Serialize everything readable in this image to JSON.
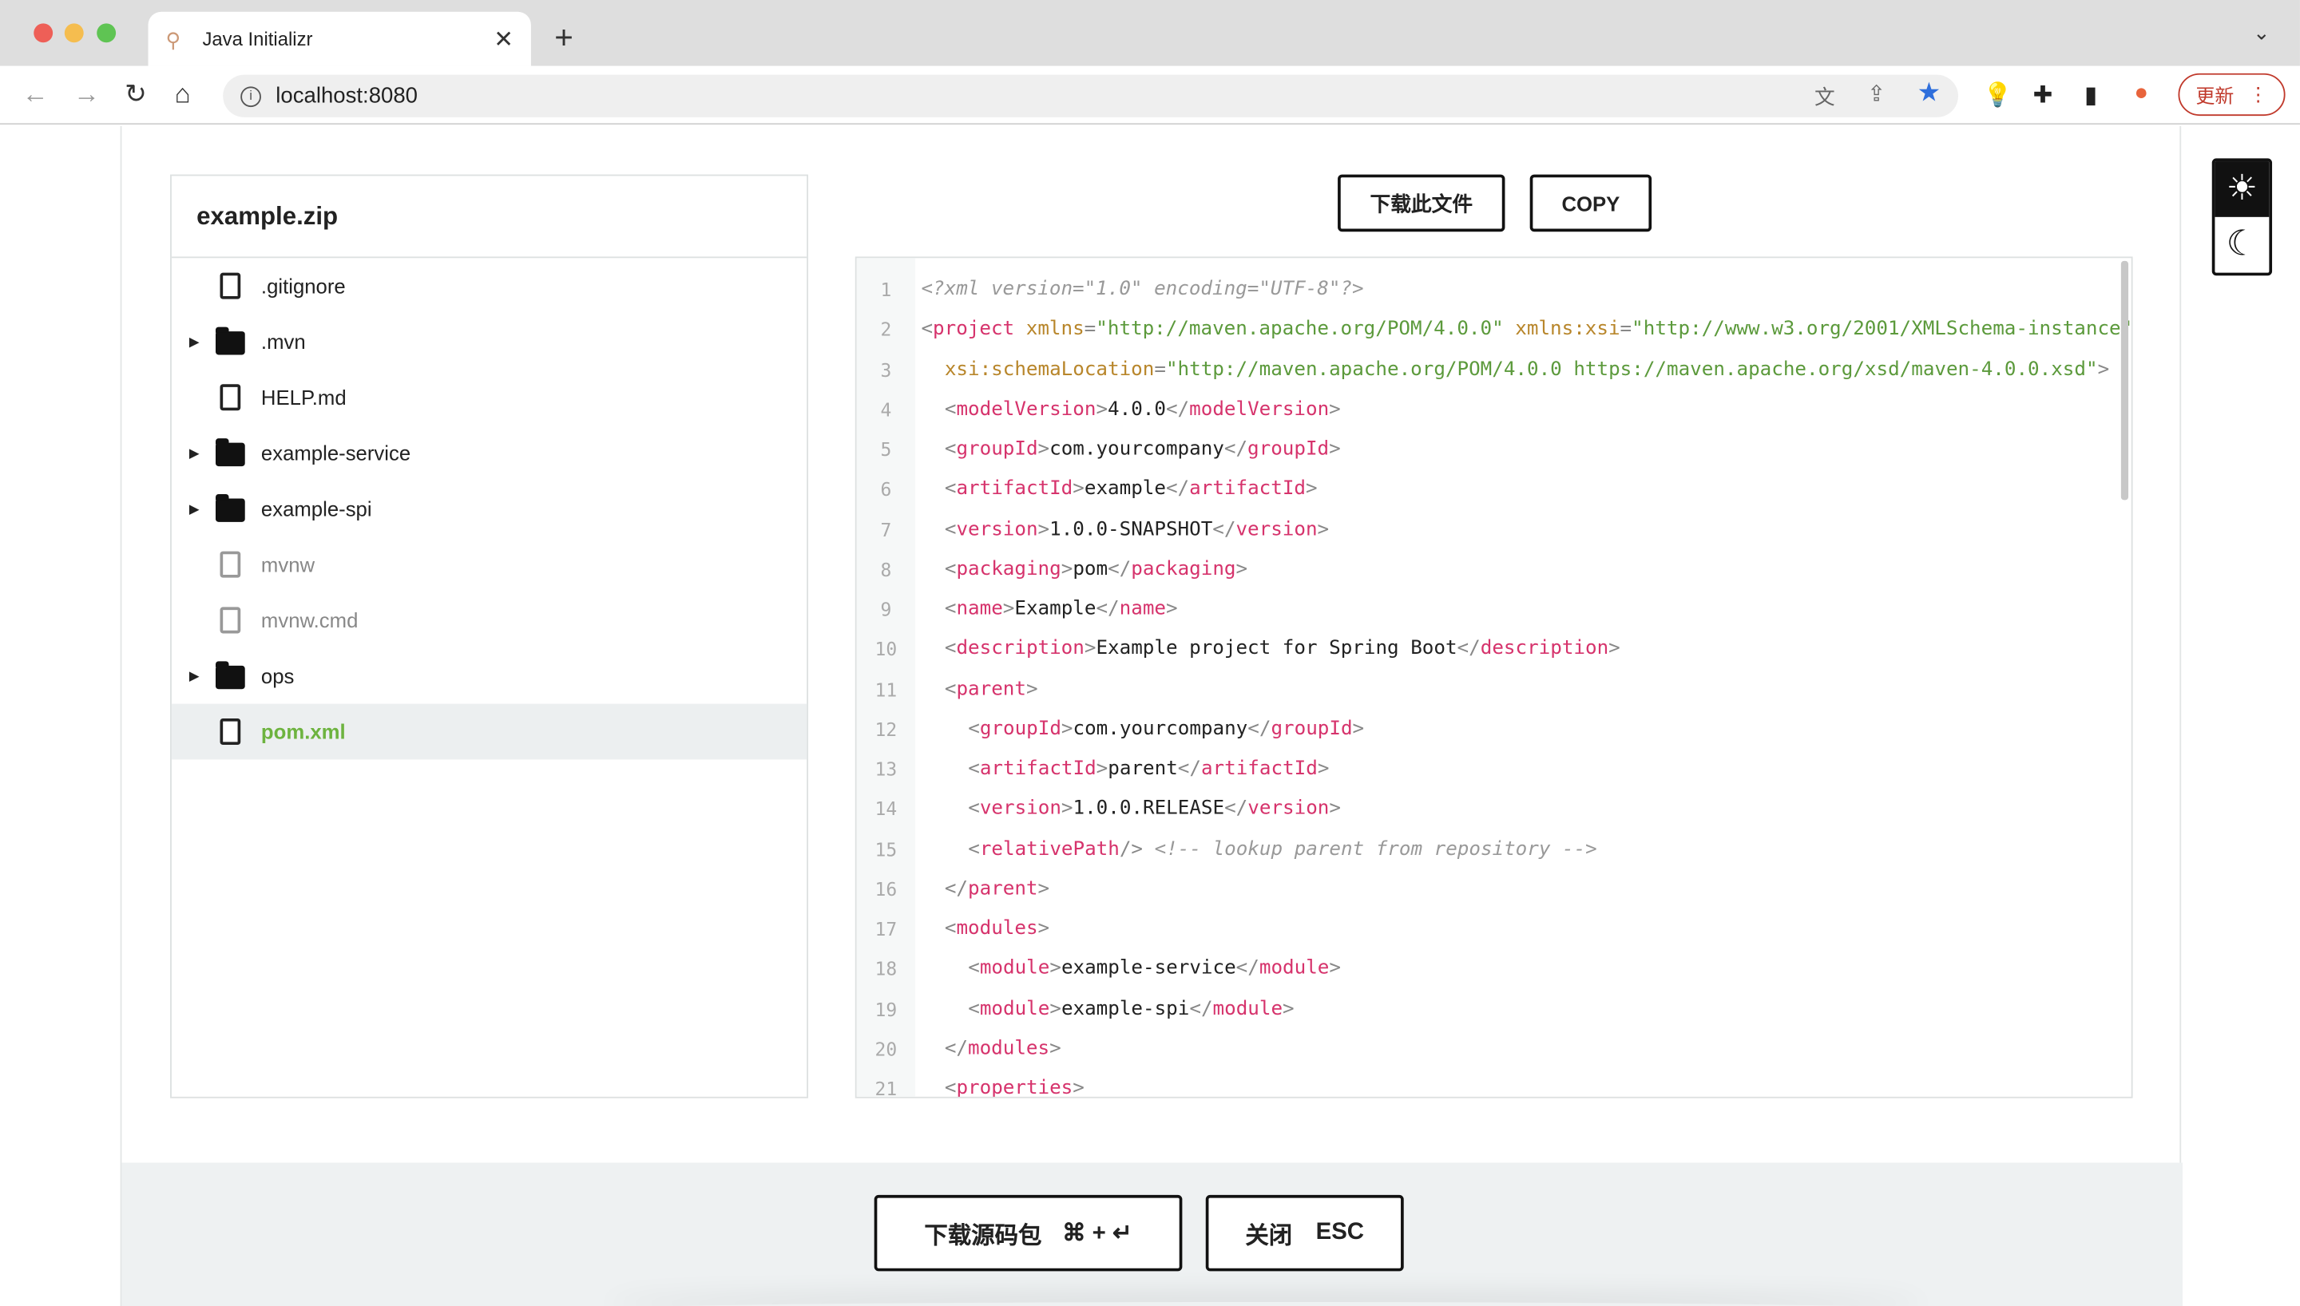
{
  "browser": {
    "tab_title": "Java Initializr",
    "url": "localhost:8080",
    "update_label": "更新",
    "colors": {
      "close": "#ee5f57",
      "minimize": "#f5bd4f",
      "maximize": "#5fc453"
    }
  },
  "tree": {
    "title": "example.zip",
    "items": [
      {
        "label": ".gitignore",
        "type": "file"
      },
      {
        "label": ".mvn",
        "type": "folder"
      },
      {
        "label": "HELP.md",
        "type": "file"
      },
      {
        "label": "example-service",
        "type": "folder"
      },
      {
        "label": "example-spi",
        "type": "folder"
      },
      {
        "label": "mvnw",
        "type": "file",
        "dim": true
      },
      {
        "label": "mvnw.cmd",
        "type": "file",
        "dim": true
      },
      {
        "label": "ops",
        "type": "folder"
      },
      {
        "label": "pom.xml",
        "type": "file",
        "selected": true
      }
    ]
  },
  "actions": {
    "download_file": "下载此文件",
    "copy": "COPY"
  },
  "code": {
    "lines": [
      {
        "n": "1",
        "i": 0,
        "t": [
          [
            "com",
            "<?xml version=\"1.0\" encoding=\"UTF-8\"?>"
          ]
        ]
      },
      {
        "n": "2",
        "i": 0,
        "t": [
          [
            "p",
            "<"
          ],
          [
            "tag",
            "project"
          ],
          [
            "txt",
            " "
          ],
          [
            "attr",
            "xmlns"
          ],
          [
            "p",
            "="
          ],
          [
            "val",
            "\"http://maven.apache.org/POM/4.0.0\""
          ],
          [
            "txt",
            " "
          ],
          [
            "attr",
            "xmlns:xsi"
          ],
          [
            "p",
            "="
          ],
          [
            "val",
            "\"http://www.w3.org/2001/XMLSchema-instance\""
          ]
        ]
      },
      {
        "n": "3",
        "i": 1,
        "t": [
          [
            "attr",
            "xsi:schemaLocation"
          ],
          [
            "p",
            "="
          ],
          [
            "val",
            "\"http://maven.apache.org/POM/4.0.0 https://maven.apache.org/xsd/maven-4.0.0.xsd\""
          ],
          [
            "p",
            ">"
          ]
        ]
      },
      {
        "n": "4",
        "i": 1,
        "t": [
          [
            "p",
            "<"
          ],
          [
            "tag",
            "modelVersion"
          ],
          [
            "p",
            ">"
          ],
          [
            "txt",
            "4.0.0"
          ],
          [
            "p",
            "</"
          ],
          [
            "tag",
            "modelVersion"
          ],
          [
            "p",
            ">"
          ]
        ]
      },
      {
        "n": "5",
        "i": 1,
        "t": [
          [
            "p",
            "<"
          ],
          [
            "tag",
            "groupId"
          ],
          [
            "p",
            ">"
          ],
          [
            "txt",
            "com.yourcompany"
          ],
          [
            "p",
            "</"
          ],
          [
            "tag",
            "groupId"
          ],
          [
            "p",
            ">"
          ]
        ]
      },
      {
        "n": "6",
        "i": 1,
        "t": [
          [
            "p",
            "<"
          ],
          [
            "tag",
            "artifactId"
          ],
          [
            "p",
            ">"
          ],
          [
            "txt",
            "example"
          ],
          [
            "p",
            "</"
          ],
          [
            "tag",
            "artifactId"
          ],
          [
            "p",
            ">"
          ]
        ]
      },
      {
        "n": "7",
        "i": 1,
        "t": [
          [
            "p",
            "<"
          ],
          [
            "tag",
            "version"
          ],
          [
            "p",
            ">"
          ],
          [
            "txt",
            "1.0.0-SNAPSHOT"
          ],
          [
            "p",
            "</"
          ],
          [
            "tag",
            "version"
          ],
          [
            "p",
            ">"
          ]
        ]
      },
      {
        "n": "8",
        "i": 1,
        "t": [
          [
            "p",
            "<"
          ],
          [
            "tag",
            "packaging"
          ],
          [
            "p",
            ">"
          ],
          [
            "txt",
            "pom"
          ],
          [
            "p",
            "</"
          ],
          [
            "tag",
            "packaging"
          ],
          [
            "p",
            ">"
          ]
        ]
      },
      {
        "n": "9",
        "i": 1,
        "t": [
          [
            "p",
            "<"
          ],
          [
            "tag",
            "name"
          ],
          [
            "p",
            ">"
          ],
          [
            "txt",
            "Example"
          ],
          [
            "p",
            "</"
          ],
          [
            "tag",
            "name"
          ],
          [
            "p",
            ">"
          ]
        ]
      },
      {
        "n": "10",
        "i": 1,
        "t": [
          [
            "p",
            "<"
          ],
          [
            "tag",
            "description"
          ],
          [
            "p",
            ">"
          ],
          [
            "txt",
            "Example project for Spring Boot"
          ],
          [
            "p",
            "</"
          ],
          [
            "tag",
            "description"
          ],
          [
            "p",
            ">"
          ]
        ]
      },
      {
        "n": "11",
        "i": 1,
        "t": [
          [
            "p",
            "<"
          ],
          [
            "tag",
            "parent"
          ],
          [
            "p",
            ">"
          ]
        ]
      },
      {
        "n": "12",
        "i": 2,
        "t": [
          [
            "p",
            "<"
          ],
          [
            "tag",
            "groupId"
          ],
          [
            "p",
            ">"
          ],
          [
            "txt",
            "com.yourcompany"
          ],
          [
            "p",
            "</"
          ],
          [
            "tag",
            "groupId"
          ],
          [
            "p",
            ">"
          ]
        ]
      },
      {
        "n": "13",
        "i": 2,
        "t": [
          [
            "p",
            "<"
          ],
          [
            "tag",
            "artifactId"
          ],
          [
            "p",
            ">"
          ],
          [
            "txt",
            "parent"
          ],
          [
            "p",
            "</"
          ],
          [
            "tag",
            "artifactId"
          ],
          [
            "p",
            ">"
          ]
        ]
      },
      {
        "n": "14",
        "i": 2,
        "t": [
          [
            "p",
            "<"
          ],
          [
            "tag",
            "version"
          ],
          [
            "p",
            ">"
          ],
          [
            "txt",
            "1.0.0.RELEASE"
          ],
          [
            "p",
            "</"
          ],
          [
            "tag",
            "version"
          ],
          [
            "p",
            ">"
          ]
        ]
      },
      {
        "n": "15",
        "i": 2,
        "t": [
          [
            "p",
            "<"
          ],
          [
            "tag",
            "relativePath"
          ],
          [
            "p",
            "/>"
          ],
          [
            "txt",
            " "
          ],
          [
            "com",
            "<!-- lookup parent from repository -->"
          ]
        ]
      },
      {
        "n": "16",
        "i": 1,
        "t": [
          [
            "p",
            "</"
          ],
          [
            "tag",
            "parent"
          ],
          [
            "p",
            ">"
          ]
        ]
      },
      {
        "n": "17",
        "i": 1,
        "t": [
          [
            "p",
            "<"
          ],
          [
            "tag",
            "modules"
          ],
          [
            "p",
            ">"
          ]
        ]
      },
      {
        "n": "18",
        "i": 2,
        "t": [
          [
            "p",
            "<"
          ],
          [
            "tag",
            "module"
          ],
          [
            "p",
            ">"
          ],
          [
            "txt",
            "example-service"
          ],
          [
            "p",
            "</"
          ],
          [
            "tag",
            "module"
          ],
          [
            "p",
            ">"
          ]
        ]
      },
      {
        "n": "19",
        "i": 2,
        "t": [
          [
            "p",
            "<"
          ],
          [
            "tag",
            "module"
          ],
          [
            "p",
            ">"
          ],
          [
            "txt",
            "example-spi"
          ],
          [
            "p",
            "</"
          ],
          [
            "tag",
            "module"
          ],
          [
            "p",
            ">"
          ]
        ]
      },
      {
        "n": "20",
        "i": 1,
        "t": [
          [
            "p",
            "</"
          ],
          [
            "tag",
            "modules"
          ],
          [
            "p",
            ">"
          ]
        ]
      },
      {
        "n": "21",
        "i": 1,
        "t": [
          [
            "p",
            "<"
          ],
          [
            "tag",
            "properties"
          ],
          [
            "p",
            ">"
          ]
        ]
      }
    ]
  },
  "footer": {
    "download_label": "下载源码包",
    "download_shortcut": "⌘ + ↵",
    "close_label": "关闭",
    "close_shortcut": "ESC"
  },
  "theme": {
    "light_icon": "sun-icon",
    "dark_icon": "moon-icon"
  }
}
